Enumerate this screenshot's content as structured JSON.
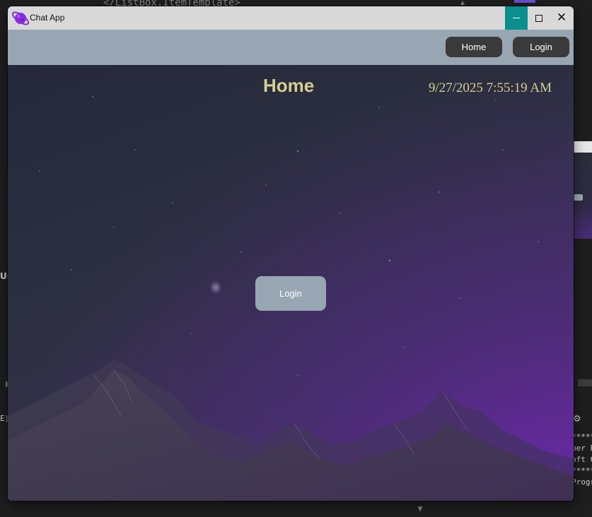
{
  "ide": {
    "code_line": "</ListBox.ItemTemplate>",
    "left_partial_label": "Us",
    "left_partial_code": "E)",
    "right_toolbar_icon": "gear-icon",
    "right_output_lines": [
      "*****",
      "ber P",
      "oft C",
      "*****",
      "Progr"
    ]
  },
  "window": {
    "title": "Chat App",
    "app_icon": "planet-icon",
    "controls": {
      "minimize": "minimize-icon",
      "maximize": "maximize-icon",
      "close": "close-icon",
      "close_glyph": "✕"
    }
  },
  "navbar": {
    "home_label": "Home",
    "login_label": "Login"
  },
  "main": {
    "heading": "Home",
    "datetime": "9/27/2025 7:55:19 AM",
    "login_button_label": "Login"
  },
  "colors": {
    "titlebar": "#d9d9d9",
    "minimize_active": "#0a8f8f",
    "navbar": "#98a6b3",
    "nav_button": "#3a3a3a",
    "heading_text": "#d4cf8e",
    "center_button": "#98a6b3",
    "background_purple": "#4b2b78"
  }
}
